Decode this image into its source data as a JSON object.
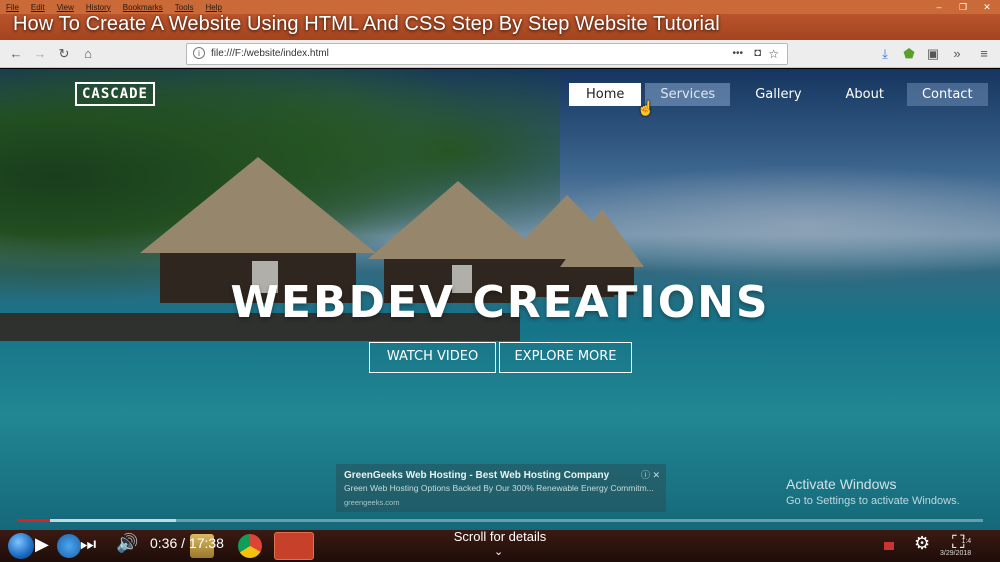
{
  "browser": {
    "menu": [
      "File",
      "Edit",
      "View",
      "History",
      "Bookmarks",
      "Tools",
      "Help"
    ],
    "url": "file:///F:/website/index.html",
    "page_actions_label": "•••"
  },
  "video": {
    "title": "How To Create A Website Using HTML And CSS Step By Step Website Tutorial",
    "current_time": "0:36",
    "separator": "/",
    "duration": "17:38",
    "progress_fraction": 0.034,
    "buffered_fraction": 0.165,
    "scroll_hint": "Scroll for details"
  },
  "site": {
    "logo": "CASCADE",
    "nav": [
      {
        "label": "Home",
        "state": "active"
      },
      {
        "label": "Services",
        "state": "hover"
      },
      {
        "label": "Gallery",
        "state": "normal"
      },
      {
        "label": "About",
        "state": "normal"
      },
      {
        "label": "Contact",
        "state": "boxed"
      }
    ],
    "hero_title": "WEBDEV CREATIONS",
    "buttons": {
      "watch": "WATCH VIDEO",
      "explore": "EXPLORE MORE"
    }
  },
  "ad": {
    "title": "GreenGeeks Web Hosting - Best Web Hosting Company",
    "description": "Green Web Hosting Options Backed By Our 300% Renewable Energy Commitm...",
    "url": "greengeeks.com",
    "close": "ⓘ ✕"
  },
  "watermark": {
    "title": "Activate Windows",
    "subtitle": "Go to Settings to activate Windows."
  },
  "clock": {
    "time": "1:4",
    "date": "3/29/2018"
  },
  "colors": {
    "accent_red": "#e0201d",
    "taskbar": "#2a120c"
  }
}
